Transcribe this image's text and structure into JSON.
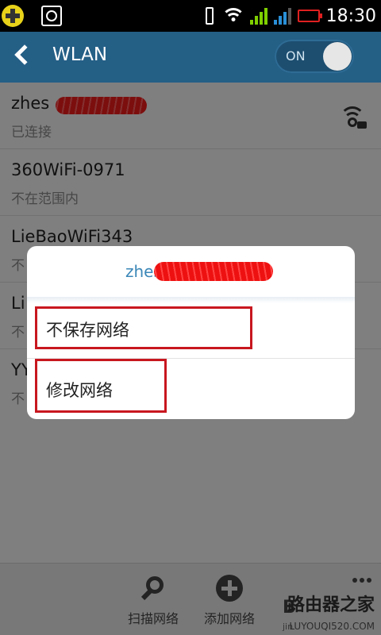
{
  "status_bar": {
    "time": "18:30",
    "icons": [
      "add-app-icon",
      "cat-app-icon",
      "vibrate-icon",
      "wifi-icon",
      "signal-icon",
      "battery-icon"
    ]
  },
  "action_bar": {
    "title": "WLAN",
    "toggle_label": "ON"
  },
  "networks": [
    {
      "name": "zhes",
      "status": "已连接",
      "secured": true
    },
    {
      "name": "360WiFi-0971",
      "status": "不在范围内"
    },
    {
      "name": "LieBaoWiFi343",
      "status": "不"
    },
    {
      "name": "Li",
      "status": "不"
    },
    {
      "name": "YY",
      "status": "不"
    }
  ],
  "dialog": {
    "title": "zhes",
    "options": [
      "不保存网络",
      "修改网络"
    ]
  },
  "bottom_bar": {
    "scan_label": "扫描网络",
    "add_label": "添加网络"
  },
  "watermark": {
    "brand": "路由器之家",
    "site": "LUYOUQI520.COM",
    "partial": "B",
    "partial2": "jin"
  },
  "colors": {
    "action_bar": "#245f86",
    "dialog_title": "#3b87b8",
    "highlight": "#c8171f",
    "battery": "#e02020"
  }
}
